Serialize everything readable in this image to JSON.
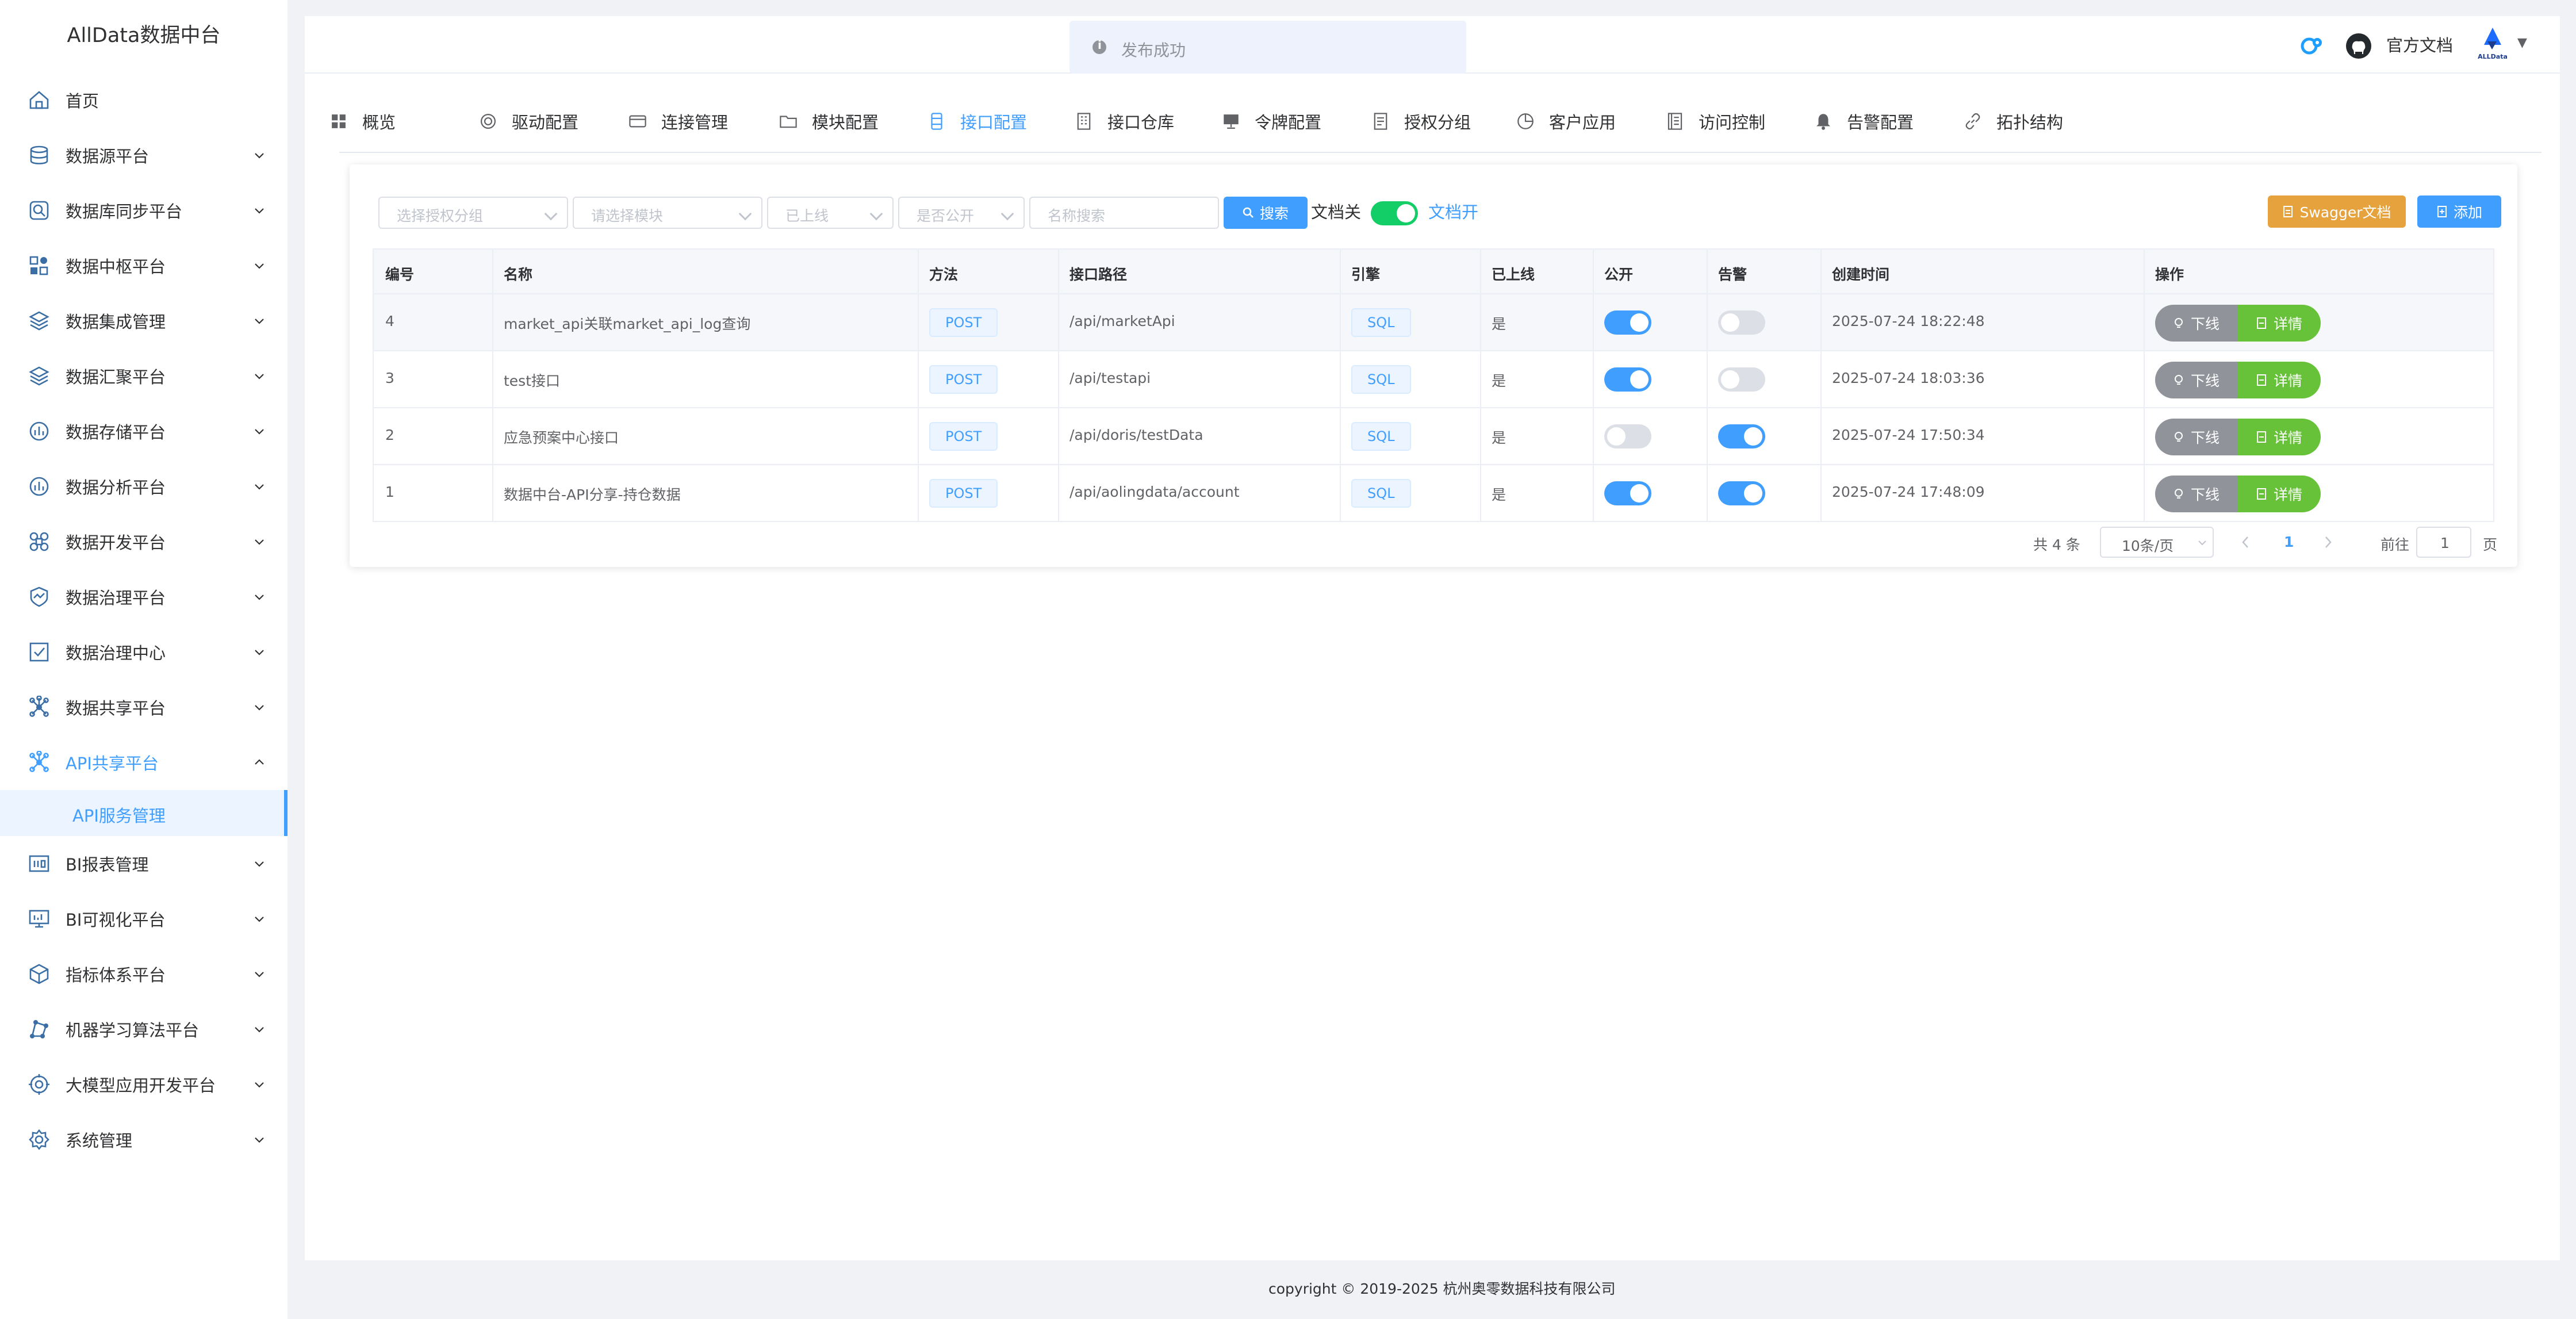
{
  "app": {
    "title": "AllData数据中台"
  },
  "sidebar": {
    "items": [
      {
        "label": "首页",
        "icon": "home-icon"
      },
      {
        "label": "数据源平台",
        "icon": "database-icon"
      },
      {
        "label": "数据库同步平台",
        "icon": "sync-icon"
      },
      {
        "label": "数据中枢平台",
        "icon": "hub-icon"
      },
      {
        "label": "数据集成管理",
        "icon": "layers-icon"
      },
      {
        "label": "数据汇聚平台",
        "icon": "stack-icon"
      },
      {
        "label": "数据存储平台",
        "icon": "storage-icon"
      },
      {
        "label": "数据分析平台",
        "icon": "analysis-icon"
      },
      {
        "label": "数据开发平台",
        "icon": "command-icon"
      },
      {
        "label": "数据治理平台",
        "icon": "chart-icon"
      },
      {
        "label": "数据治理中心",
        "icon": "checkbox-icon"
      },
      {
        "label": "数据共享平台",
        "icon": "share-icon"
      },
      {
        "label": "API共享平台",
        "icon": "api-icon"
      },
      {
        "label": "BI报表管理",
        "icon": "report-icon"
      },
      {
        "label": "BI可视化平台",
        "icon": "monitor-icon"
      },
      {
        "label": "指标体系平台",
        "icon": "cube-icon"
      },
      {
        "label": "机器学习算法平台",
        "icon": "ml-icon"
      },
      {
        "label": "大模型应用开发平台",
        "icon": "model-icon"
      },
      {
        "label": "系统管理",
        "icon": "settings-icon"
      }
    ],
    "submenu_active": "API服务管理"
  },
  "header": {
    "toast": "发布成功",
    "doc_link": "官方文档",
    "brand_logo_text": "ALLData"
  },
  "tabs": [
    {
      "label": "概览",
      "icon": "grid-icon"
    },
    {
      "label": "驱动配置",
      "icon": "driver-icon"
    },
    {
      "label": "连接管理",
      "icon": "card-icon"
    },
    {
      "label": "模块配置",
      "icon": "folder-icon"
    },
    {
      "label": "接口配置",
      "icon": "interface-icon"
    },
    {
      "label": "接口仓库",
      "icon": "building-icon"
    },
    {
      "label": "令牌配置",
      "icon": "token-icon"
    },
    {
      "label": "授权分组",
      "icon": "document-icon"
    },
    {
      "label": "客户应用",
      "icon": "pie-icon"
    },
    {
      "label": "访问控制",
      "icon": "list-icon"
    },
    {
      "label": "告警配置",
      "icon": "bell-icon"
    },
    {
      "label": "拓扑结构",
      "icon": "link-icon"
    }
  ],
  "active_tab": "接口配置",
  "filters": {
    "auth_group": "选择授权分组",
    "module": "请选择模块",
    "online": "已上线",
    "public": "是否公开",
    "name_search": "名称搜索",
    "search_button": "搜索",
    "doc_off": "文档关",
    "doc_on": "文档开",
    "swagger_button": "Swagger文档",
    "add_button": "添加"
  },
  "table": {
    "columns": [
      "编号",
      "名称",
      "方法",
      "接口路径",
      "引擎",
      "已上线",
      "公开",
      "告警",
      "创建时间",
      "操作"
    ],
    "rows": [
      {
        "id": "4",
        "name": "market_api关联market_api_log查询",
        "method": "POST",
        "path": "/api/marketApi",
        "engine": "SQL",
        "online": "是",
        "public": true,
        "alarm": false,
        "created": "2025-07-24 18:22:48"
      },
      {
        "id": "3",
        "name": "test接口",
        "method": "POST",
        "path": "/api/testapi",
        "engine": "SQL",
        "online": "是",
        "public": true,
        "alarm": false,
        "created": "2025-07-24 18:03:36"
      },
      {
        "id": "2",
        "name": "应急预案中心接口",
        "method": "POST",
        "path": "/api/doris/testData",
        "engine": "SQL",
        "online": "是",
        "public": false,
        "alarm": true,
        "created": "2025-07-24 17:50:34"
      },
      {
        "id": "1",
        "name": "数据中台-API分享-持仓数据",
        "method": "POST",
        "path": "/api/aolingdata/account",
        "engine": "SQL",
        "online": "是",
        "public": true,
        "alarm": true,
        "created": "2025-07-24 17:48:09"
      }
    ],
    "offline_label": "下线",
    "detail_label": "详情"
  },
  "pagination": {
    "total": "共 4 条",
    "page_size": "10条/页",
    "current": "1",
    "goto_prefix": "前往",
    "goto_value": "1",
    "goto_suffix": "页"
  },
  "footer": "copyright © 2019-2025 杭州奥零数据科技有限公司",
  "colors": {
    "primary": "#409eff",
    "success": "#67c23a",
    "warning": "#e6a23c",
    "info": "#909399"
  }
}
